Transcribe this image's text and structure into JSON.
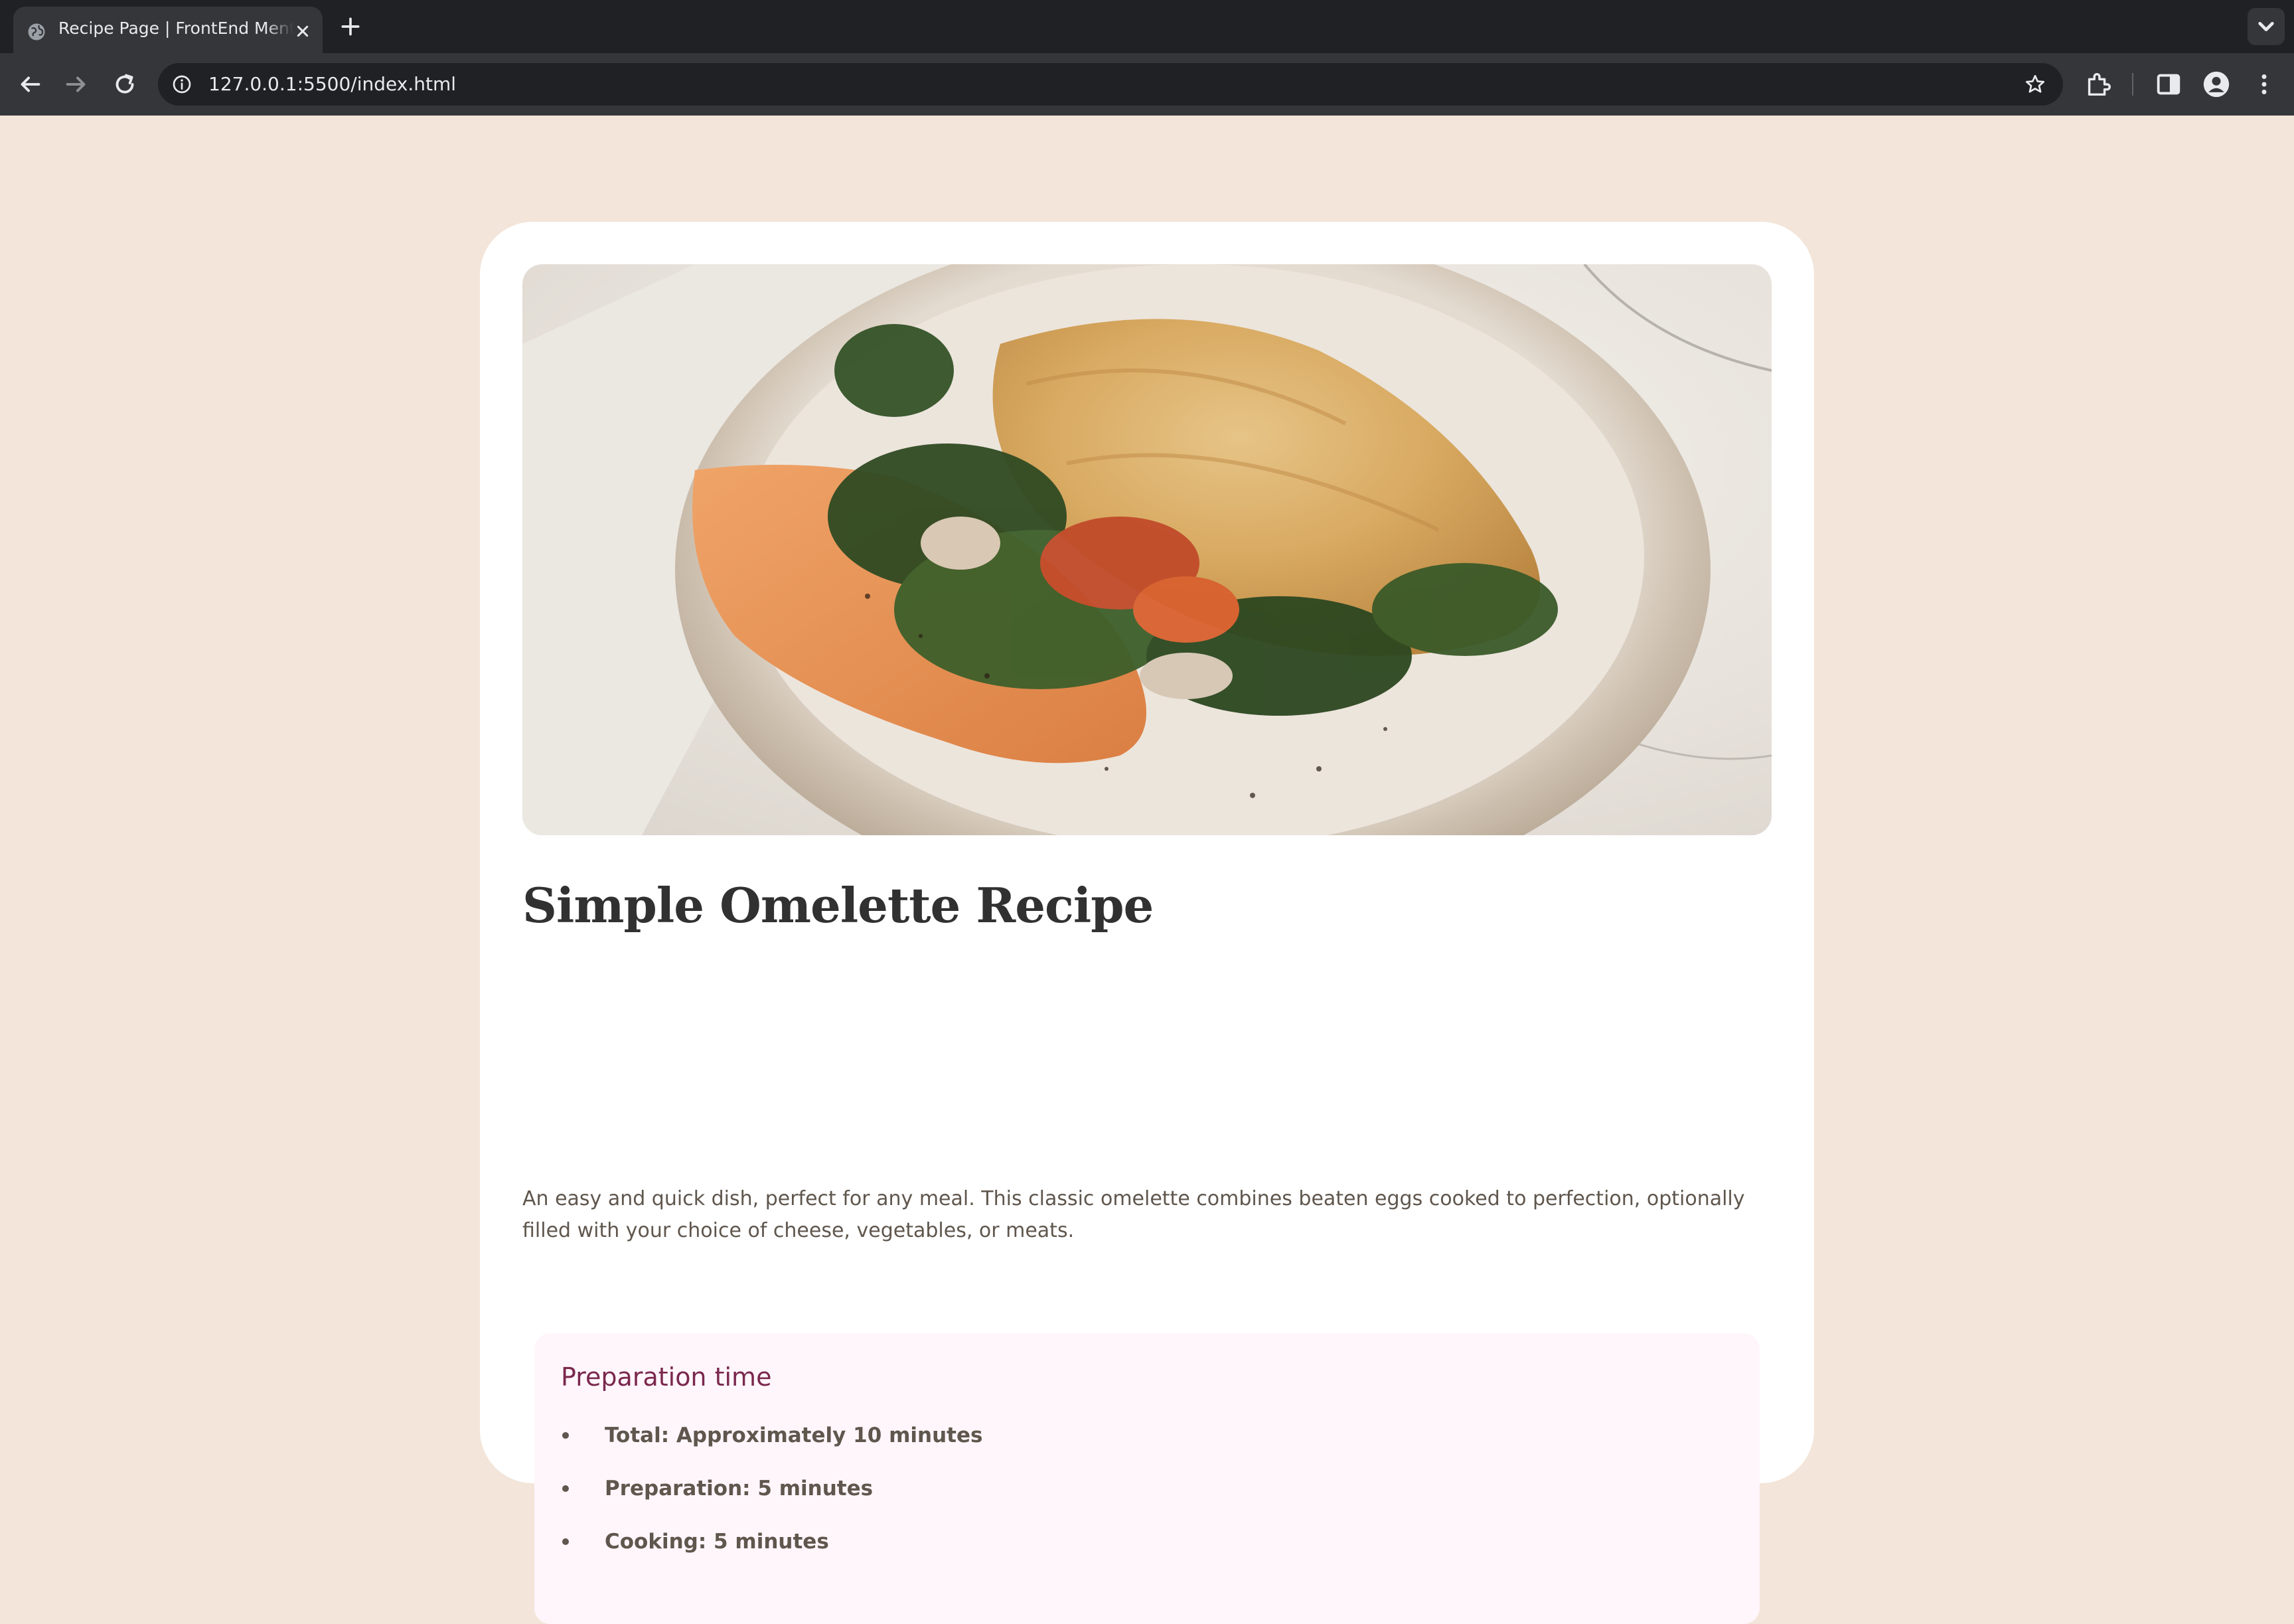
{
  "browser": {
    "tab_title": "Recipe Page | FrontEnd Mentor",
    "url": "127.0.0.1:5500/index.html"
  },
  "recipe": {
    "image_alt": "Omelette folded over spinach, mushrooms and tomato with a smear of orange spread on a ceramic plate",
    "title": "Simple Omelette Recipe",
    "intro": "An easy and quick dish, perfect for any meal. This classic omelette combines beaten eggs cooked to perfection, optionally filled with your choice of cheese, vegetables, or meats.",
    "preparation": {
      "heading": "Preparation time",
      "items": [
        {
          "label": "Total:",
          "value": " Approximately 10 minutes"
        },
        {
          "label": "Preparation:",
          "value": " 5 minutes"
        },
        {
          "label": "Cooking:",
          "value": " 5 minutes"
        }
      ]
    }
  },
  "colors": {
    "page_background": "#f3e5d9",
    "card_background": "#ffffff",
    "heading_text": "#313131",
    "body_text": "#5f564d",
    "prep_box_background": "#fff6fb",
    "prep_heading": "#7a284e",
    "browser_frame": "#202124",
    "browser_toolbar": "#35363a"
  },
  "icons": {
    "tab_favicon": "globe-icon",
    "tab_close": "close-icon",
    "new_tab": "plus-icon",
    "tab_search": "chevron-down-icon",
    "back": "arrow-left-icon",
    "forward": "arrow-right-icon",
    "reload": "reload-icon",
    "site_info": "info-icon",
    "bookmark": "star-icon",
    "extensions": "puzzle-icon",
    "side_panel": "side-panel-icon",
    "profile": "profile-icon",
    "menu": "kebab-menu-icon"
  }
}
